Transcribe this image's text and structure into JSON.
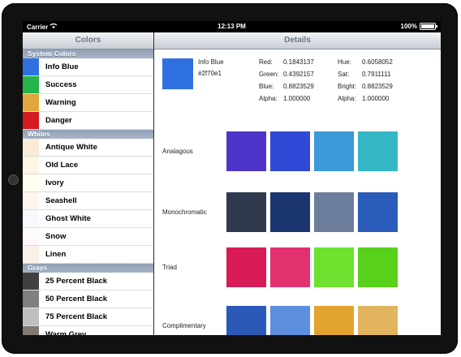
{
  "status_bar": {
    "carrier": "Carrier",
    "time": "12:13 PM",
    "battery": "100%",
    "battery_level": 1.0
  },
  "master": {
    "title": "Colors",
    "sections": [
      {
        "title": "System Colors",
        "items": [
          {
            "label": "Info Blue",
            "color": "#2f70e1"
          },
          {
            "label": "Success",
            "color": "#24b64a"
          },
          {
            "label": "Warning",
            "color": "#e0a73a"
          },
          {
            "label": "Danger",
            "color": "#d51a22"
          }
        ]
      },
      {
        "title": "Whites",
        "items": [
          {
            "label": "Antique White",
            "color": "#faebd7"
          },
          {
            "label": "Old Lace",
            "color": "#fdf5e6"
          },
          {
            "label": "Ivory",
            "color": "#fffff0"
          },
          {
            "label": "Seashell",
            "color": "#fff5ee"
          },
          {
            "label": "Ghost White",
            "color": "#f8f8ff"
          },
          {
            "label": "Snow",
            "color": "#fffafa"
          },
          {
            "label": "Linen",
            "color": "#faf0e6"
          }
        ]
      },
      {
        "title": "Grays",
        "items": [
          {
            "label": "25 Percent Black",
            "color": "#404040"
          },
          {
            "label": "50 Percent Black",
            "color": "#808080"
          },
          {
            "label": "75 Percent Black",
            "color": "#bfbfbf"
          },
          {
            "label": "Warm Grey",
            "color": "#857a72"
          }
        ]
      }
    ]
  },
  "detail": {
    "title": "Details",
    "name": "Info Blue",
    "hex": "#2f70e1",
    "swatch_color": "#2f70e1",
    "values": {
      "red": {
        "label": "Red:",
        "value": "0.1843137"
      },
      "green": {
        "label": "Green:",
        "value": "0.4392157"
      },
      "blue": {
        "label": "Blue:",
        "value": "0.8823529"
      },
      "alpha1": {
        "label": "Alpha:",
        "value": "1.000000"
      },
      "hue": {
        "label": "Hue:",
        "value": "0.6058052"
      },
      "sat": {
        "label": "Sat:",
        "value": "0.7911111"
      },
      "bright": {
        "label": "Bright:",
        "value": "0.8823529"
      },
      "alpha2": {
        "label": "Alpha:",
        "value": "1.000000"
      }
    },
    "schemes": [
      {
        "label": "Analagous",
        "colors": [
          "#4e34c9",
          "#2f49d6",
          "#3a99d6",
          "#34b7c4"
        ]
      },
      {
        "label": "Monochromatic",
        "colors": [
          "#2f3a4f",
          "#1a3570",
          "#6d7e9d",
          "#2a5bb8"
        ]
      },
      {
        "label": "Triad",
        "colors": [
          "#d81a57",
          "#e3306f",
          "#6ee22e",
          "#57d11a"
        ]
      },
      {
        "label": "Complimentary",
        "colors": [
          "#2a59b8",
          "#5e8ede",
          "#e2a32f",
          "#e2b460"
        ]
      }
    ]
  }
}
